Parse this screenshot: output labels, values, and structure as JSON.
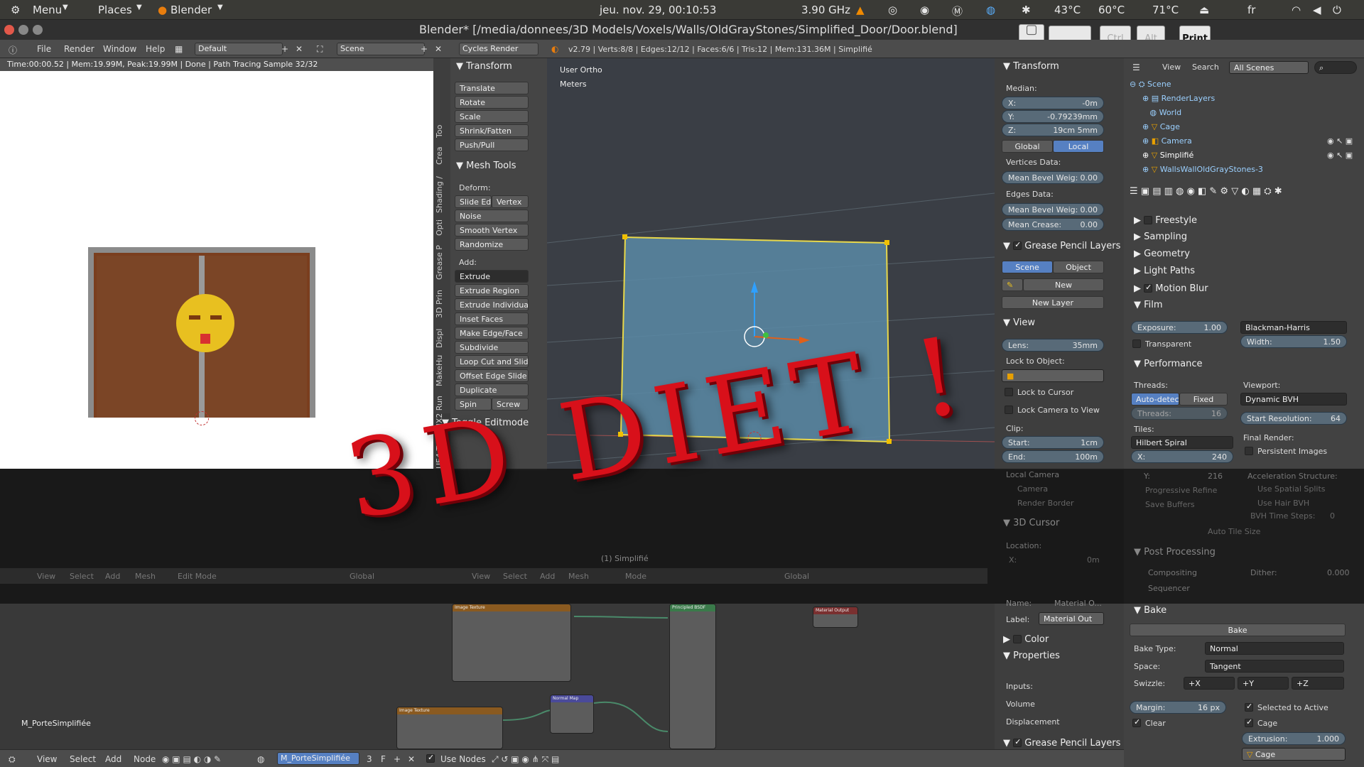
{
  "os_bar": {
    "menu": "Menu",
    "places": "Places",
    "app": "Blender",
    "clock": "jeu. nov. 29, 00:10:53",
    "cpu_freq": "3.90 GHz",
    "temps": [
      "43°C",
      "60°C",
      "71°C"
    ],
    "lang": "fr"
  },
  "window": {
    "title": "Blender* [/media/donnees/3D Models/Voxels/Walls/OldGrayStones/Simplified_Door/Door.blend]"
  },
  "key_overlay": [
    "",
    "",
    "Ctrl",
    "Alt",
    "Print"
  ],
  "menubar": {
    "items": [
      "File",
      "Render",
      "Window",
      "Help"
    ],
    "layout": "Default",
    "scene": "Scene",
    "engine": "Cycles Render",
    "stats": "v2.79 | Verts:8/8 | Edges:12/12 | Faces:6/6 | Tris:12 | Mem:131.36M | Simplifié"
  },
  "render_view": {
    "info": "Time:00:00.52 | Mem:19.99M, Peak:19.99M | Done | Path Tracing Sample 32/32"
  },
  "tool_tabs": [
    "Too",
    "Crea",
    "Shading /",
    "Opti",
    "Grease P",
    "3D Prin",
    "Displ",
    "MakeHu",
    "MHX2 Run",
    "UE4 To"
  ],
  "tool_shelf": {
    "transform": {
      "title": "Transform",
      "buttons": [
        "Translate",
        "Rotate",
        "Scale",
        "Shrink/Fatten",
        "Push/Pull"
      ]
    },
    "mesh_tools": {
      "title": "Mesh Tools",
      "deform": "Deform:",
      "slide_edge": "Slide Ed",
      "vertex": "Vertex",
      "deform_buttons": [
        "Noise",
        "Smooth Vertex",
        "Randomize"
      ],
      "add": "Add:",
      "extrude": "Extrude",
      "add_buttons": [
        "Extrude Region",
        "Extrude Individual",
        "Inset Faces",
        "Make Edge/Face",
        "Subdivide",
        "Loop Cut and Slide",
        "Offset Edge Slide",
        "Duplicate"
      ],
      "spin": "Spin",
      "screw": "Screw"
    },
    "toggle_editmode": "Toggle Editmode"
  },
  "viewport": {
    "view_name": "User Ortho",
    "units": "Meters"
  },
  "n_panel": {
    "transform": "Transform",
    "median": "Median:",
    "x": {
      "label": "X:",
      "value": "-0m"
    },
    "y": {
      "label": "Y:",
      "value": "-0.79239mm"
    },
    "z": {
      "label": "Z:",
      "value": "19cm 5mm"
    },
    "global": "Global",
    "local": "Local",
    "vertices_data": "Vertices Data:",
    "vert_bevel": {
      "label": "Mean Bevel Weig:",
      "value": "0.00"
    },
    "edges_data": "Edges Data:",
    "edge_bevel": {
      "label": "Mean Bevel Weig:",
      "value": "0.00"
    },
    "crease": {
      "label": "Mean Crease:",
      "value": "0.00"
    },
    "grease_pencil": "Grease Pencil Layers",
    "gp_scene": "Scene",
    "gp_object": "Object",
    "gp_new": "New",
    "gp_new_layer": "New Layer",
    "view": "View",
    "lens": {
      "label": "Lens:",
      "value": "35mm"
    },
    "lock_to_object": "Lock to Object:",
    "lock_cursor": "Lock to Cursor",
    "lock_camera": "Lock Camera to View",
    "clip": "Clip:",
    "clip_start": {
      "label": "Start:",
      "value": "1cm"
    },
    "clip_end": {
      "label": "End:",
      "value": "100m"
    },
    "local_camera": "Local Camera",
    "camera": "Camera",
    "render_border": "Render Border",
    "cursor_3d": "3D Cursor",
    "location": "Location:",
    "loc_x": {
      "label": "X:",
      "value": "0m"
    }
  },
  "node_side": {
    "name_label": "Name:",
    "name_value": "Material O...",
    "label_label": "Label:",
    "label_value": "Material Out",
    "color": "Color",
    "properties": "Properties",
    "inputs": [
      "Inputs:",
      "Volume",
      "Displacement"
    ],
    "grease_pencil": "Grease Pencil Layers"
  },
  "outliner": {
    "view": "View",
    "search": "Search",
    "filter": "All Scenes",
    "items": [
      "Scene",
      "RenderLayers",
      "World",
      "Cage",
      "Camera",
      "Simplifié",
      "WallsWallOldGrayStones-3"
    ]
  },
  "render_props": {
    "freestyle": "Freestyle",
    "sampling": "Sampling",
    "geometry": "Geometry",
    "light_paths": "Light Paths",
    "motion_blur": "Motion Blur",
    "film": "Film",
    "exposure": {
      "label": "Exposure:",
      "value": "1.00"
    },
    "filter": "Blackman-Harris",
    "transparent": "Transparent",
    "width": {
      "label": "Width:",
      "value": "1.50"
    },
    "performance": "Performance",
    "threads": "Threads:",
    "auto_detect": "Auto-detect",
    "fixed": "Fixed",
    "threads_count": {
      "label": "Threads:",
      "value": "16"
    },
    "viewport": "Viewport:",
    "bvh": "Dynamic BVH",
    "start_res": {
      "label": "Start Resolution:",
      "value": "64"
    },
    "tiles": "Tiles:",
    "tile_order": "Hilbert Spiral",
    "tile_x": {
      "label": "X:",
      "value": "240"
    },
    "tile_y": {
      "label": "Y:",
      "value": "216"
    },
    "final_render": "Final Render:",
    "persistent_images": "Persistent Images",
    "accel_structure": "Acceleration Structure:",
    "progressive_refine": "Progressive Refine",
    "save_buffers": "Save Buffers",
    "spatial_splits": "Use Spatial Splits",
    "hair_bvh": "Use Hair BVH",
    "bvh_steps": {
      "label": "BVH Time Steps:",
      "value": "0"
    },
    "auto_tile": "Auto Tile Size",
    "post_processing": "Post Processing",
    "compositing": "Compositing",
    "sequencer": "Sequencer",
    "dither": {
      "label": "Dither:",
      "value": "0.000"
    },
    "bake": "Bake",
    "bake_button": "Bake",
    "bake_type": {
      "label": "Bake Type:",
      "value": "Normal"
    },
    "space": {
      "label": "Space:",
      "value": "Tangent"
    },
    "swizzle": {
      "label": "Swizzle:",
      "values": [
        "+X",
        "+Y",
        "+Z"
      ]
    },
    "margin": {
      "label": "Margin:",
      "value": "16 px"
    },
    "selected_to_active": "Selected to Active",
    "clear": "Clear",
    "cage": "Cage",
    "extrusion": {
      "label": "Extrusion:",
      "value": "1.000"
    },
    "cage_object": "Cage"
  },
  "editor_header": {
    "items": [
      "View",
      "Select",
      "Add",
      "Mesh"
    ],
    "mode": "Edit Mode",
    "orientation": "Global",
    "items2": [
      "View",
      "Select",
      "Add",
      "Mesh"
    ],
    "mode2": "Mode",
    "orientation2": "Global"
  },
  "overlay_text": "3D DIET !",
  "viewport_object_label": "(1) Simplifié",
  "node_editor": {
    "material_name": "M_PorteSimplifiée",
    "nodes": [
      "Image Texture",
      "Image Texture",
      "Normal Map",
      "Principled BSDF",
      "Material Output"
    ]
  },
  "bottom_bar": {
    "items": [
      "View",
      "Select",
      "Add",
      "Node"
    ],
    "material": "M_PorteSimplifiée",
    "users": "3",
    "fake": "F",
    "use_nodes": "Use Nodes"
  },
  "colors": {
    "accent": "#5680c2",
    "selection": "#e8a000",
    "mesh_face": "#5a8aa6",
    "overlay_red": "#d8101a"
  }
}
